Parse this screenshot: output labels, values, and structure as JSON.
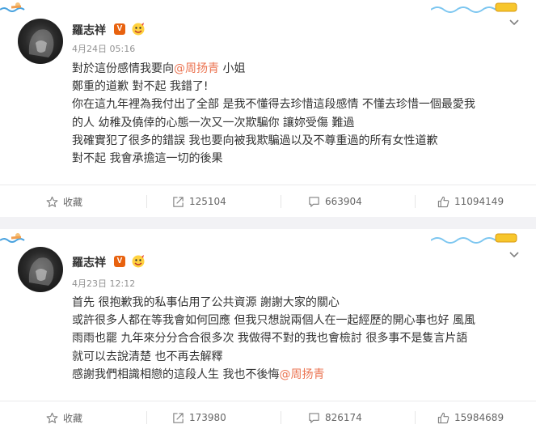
{
  "posts": [
    {
      "author": "羅志祥",
      "verified_badge": "V",
      "time": "4月24日 05:16",
      "lines": [
        {
          "text": "對於這份感情我要向",
          "mention": "@周扬青",
          "after": " 小姐"
        },
        {
          "text": "鄭重的道歉 對不起 我錯了!"
        },
        {
          "text": "你在這九年裡為我付出了全部 是我不懂得去珍惜這段感情 不懂去珍惜一個最愛我"
        },
        {
          "text": "的人 幼稚及僥倖的心態一次又一次欺騙你 讓妳受傷 難過"
        },
        {
          "text": "我確實犯了很多的錯誤 我也要向被我欺騙過以及不尊重過的所有女性道歉"
        },
        {
          "text": "對不起   我會承擔這一切的後果"
        }
      ],
      "actions": {
        "favorite": "收藏",
        "repost": "125104",
        "comment": "663904",
        "like": "11094149"
      }
    },
    {
      "author": "羅志祥",
      "verified_badge": "V",
      "time": "4月23日 12:12",
      "lines": [
        {
          "text": "首先 很抱歉我的私事佔用了公共資源 謝謝大家的關心"
        },
        {
          "text": "或許很多人都在等我會如何回應 但我只想說兩個人在一起經歷的開心事也好 風風"
        },
        {
          "text": "雨雨也罷 九年來分分合合很多次 我做得不對的我也會檢討 很多事不是隻言片語"
        },
        {
          "text": "就可以去說清楚 也不再去解釋"
        },
        {
          "text": "感謝我們相識相戀的這段人生 我也不後悔",
          "mention": "@周扬青",
          "after": ""
        }
      ],
      "actions": {
        "favorite": "收藏",
        "repost": "173980",
        "comment": "826174",
        "like": "15984689"
      }
    }
  ],
  "icons": {
    "favorite": "star-outline-icon",
    "repost": "share-arrow-icon",
    "comment": "comment-bubble-icon",
    "like": "thumbs-up-icon",
    "more": "chevron-down-icon"
  },
  "colors": {
    "mention": "#eb7350",
    "badge": "#e8620f",
    "muted": "#939393"
  }
}
